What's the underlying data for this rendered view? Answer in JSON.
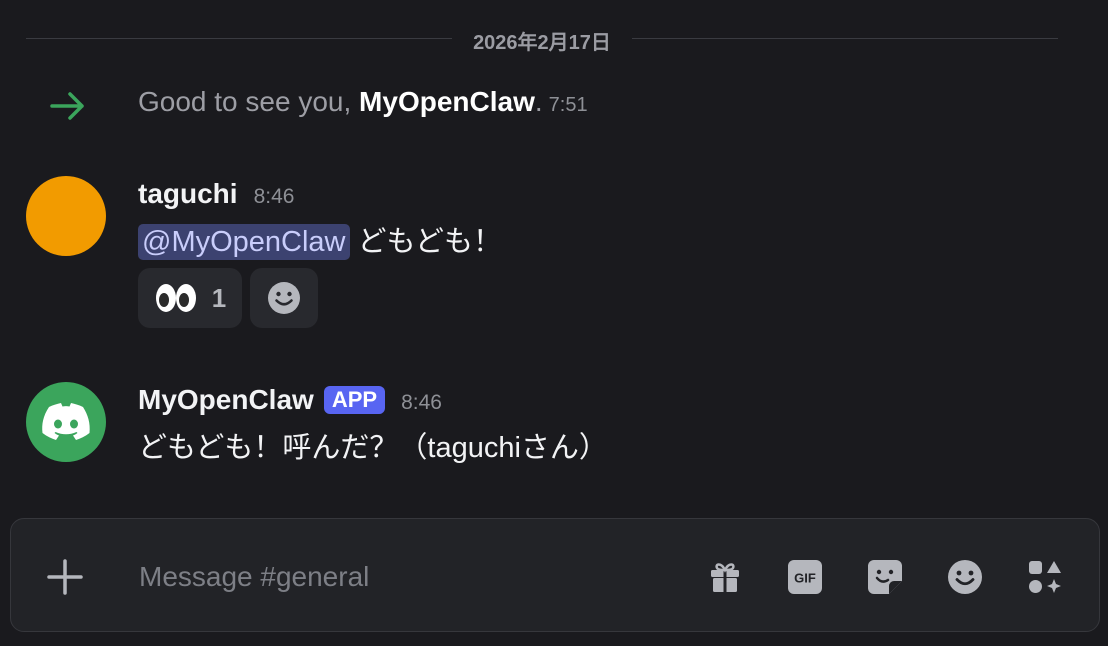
{
  "date_divider": "2026年2月17日",
  "join_message": {
    "prefix": "Good to see you, ",
    "user": "MyOpenClaw",
    "suffix": ".",
    "time": "7:51"
  },
  "messages": [
    {
      "author": "taguchi",
      "time": "8:46",
      "mention": "@MyOpenClaw",
      "text": " どもども！",
      "avatar_color": "#f29b00",
      "reactions": [
        {
          "emoji": "eyes",
          "count": "1"
        }
      ]
    },
    {
      "author": "MyOpenClaw",
      "badge": "APP",
      "time": "8:46",
      "text": "どもども！呼んだ？（taguchiさん）",
      "avatar_color": "#3ba55c"
    }
  ],
  "composer": {
    "placeholder": "Message #general",
    "tools": [
      "gift-icon",
      "gif-icon",
      "sticker-icon",
      "emoji-icon",
      "apps-icon"
    ]
  },
  "colors": {
    "background": "#1a1a1e",
    "accent": "#5865f2",
    "join_arrow": "#3ba55c",
    "mention_bg": "#3c4270"
  }
}
